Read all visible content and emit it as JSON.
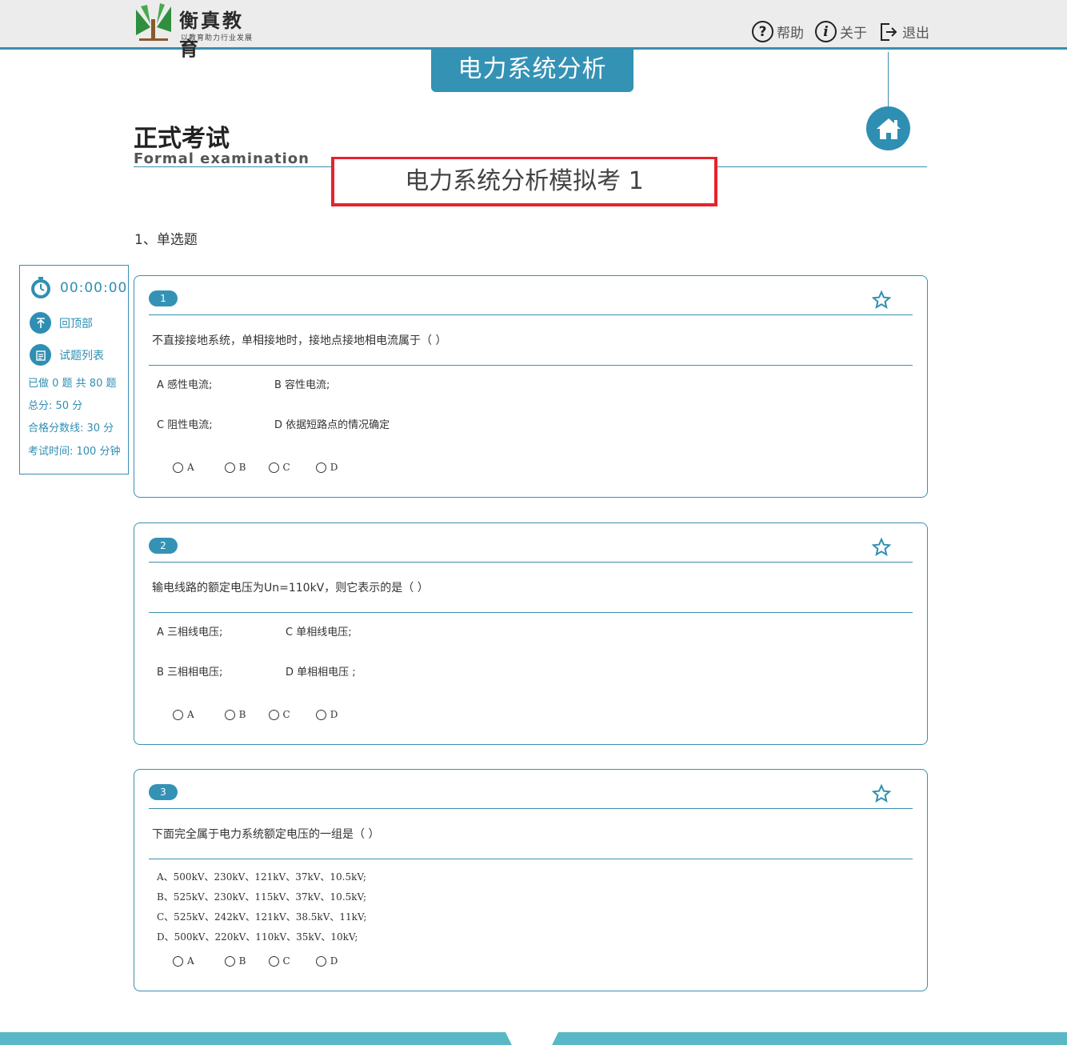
{
  "header": {
    "logo_text": "衡真教育",
    "logo_subtitle": "以教育助力行业发展",
    "nav": [
      {
        "label": "帮助",
        "icon": "help-icon",
        "glyph": "?"
      },
      {
        "label": "关于",
        "icon": "info-icon",
        "glyph": "i"
      },
      {
        "label": "退出",
        "icon": "logout-icon",
        "glyph": ""
      }
    ]
  },
  "course_tab": "电力系统分析",
  "page": {
    "title": "正式考试",
    "subtitle": "Formal examination",
    "exam_name": "电力系统分析模拟考 1"
  },
  "section_title": "1、单选题",
  "sidebar": {
    "timer": "00:00:00",
    "back_to_top": "回顶部",
    "question_list": "试题列表",
    "progress": "已做 0 题  共 80 题",
    "total_score": "总分: 50 分",
    "pass_line": "合格分数线: 30 分",
    "exam_time": "考试时间: 100 分钟"
  },
  "questions": [
    {
      "number": "1",
      "text": "不直接接地系统，单相接地时，接地点接地相电流属于（  ）",
      "options": [
        "A 感性电流;",
        "B 容性电流;",
        "C 阻性电流;",
        "D 依据短路点的情况确定"
      ],
      "choices": [
        "A",
        "B",
        "C",
        "D"
      ]
    },
    {
      "number": "2",
      "text": "输电线路的额定电压为Un=110kV，则它表示的是（  ）",
      "options": [
        "A 三相线电压;",
        "C 单相线电压;",
        "B 三相相电压;",
        "D 单相相电压 ;"
      ],
      "choices": [
        "A",
        "B",
        "C",
        "D"
      ]
    },
    {
      "number": "3",
      "text": "下面完全属于电力系统额定电压的一组是（  ）",
      "options": [
        "A、500kV、230kV、121kV、37kV、10.5kV;",
        "B、525kV、230kV、115kV、37kV、10.5kV;",
        "C、525kV、242kV、121kV、38.5kV、11kV;",
        "D、500kV、220kV、110kV、35kV、10kV;"
      ],
      "choices": [
        "A",
        "B",
        "C",
        "D"
      ]
    }
  ],
  "colors": {
    "accent": "#3492b5",
    "highlight_border": "#e8222b",
    "footer": "#5ab8c6"
  }
}
